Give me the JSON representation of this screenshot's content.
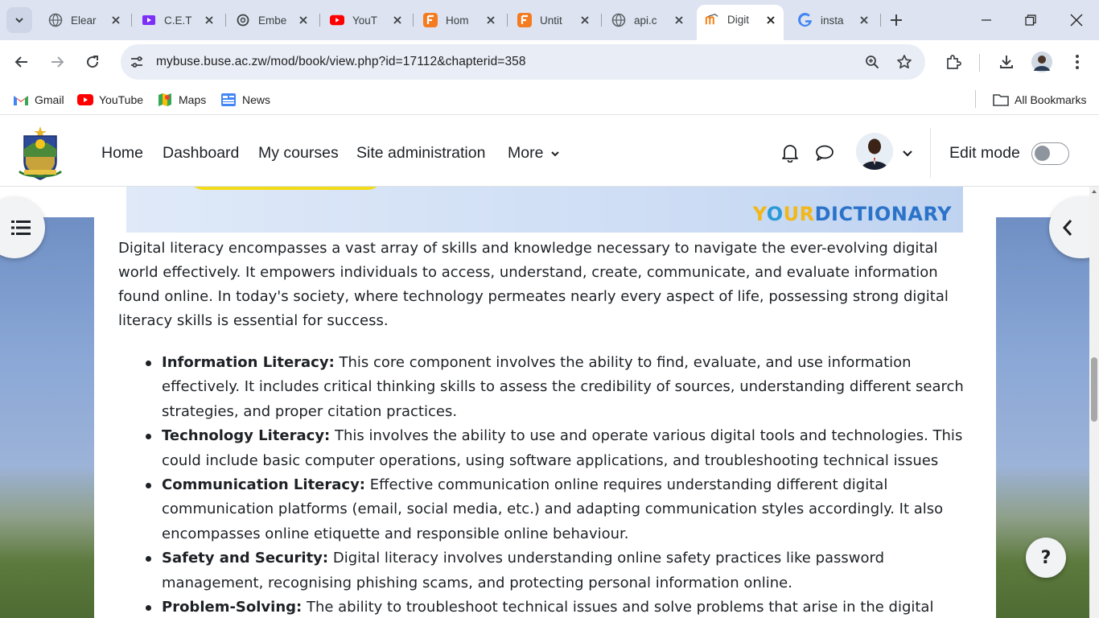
{
  "browser": {
    "tabs": [
      {
        "label": "Elear",
        "icon": "globe-icon"
      },
      {
        "label": "C.E.T",
        "icon": "video-icon"
      },
      {
        "label": "Embe",
        "icon": "openai-icon"
      },
      {
        "label": "YouT",
        "icon": "youtube-icon"
      },
      {
        "label": "Hom",
        "icon": "formative-icon"
      },
      {
        "label": "Untit",
        "icon": "formative-icon"
      },
      {
        "label": "api.c",
        "icon": "globe-icon"
      },
      {
        "label": "Digit",
        "icon": "moodle-icon",
        "active": true
      },
      {
        "label": "insta",
        "icon": "google-icon"
      }
    ],
    "url": "mybuse.buse.ac.zw/mod/book/view.php?id=17112&chapterid=358",
    "bookmarks": [
      {
        "label": "Gmail",
        "icon": "gmail-icon"
      },
      {
        "label": "YouTube",
        "icon": "youtube-icon"
      },
      {
        "label": "Maps",
        "icon": "maps-icon"
      },
      {
        "label": "News",
        "icon": "news-icon"
      }
    ],
    "all_bookmarks": "All Bookmarks"
  },
  "site_nav": {
    "links": [
      "Home",
      "Dashboard",
      "My courses",
      "Site administration",
      "More"
    ],
    "edit_mode": "Edit mode",
    "edit_mode_on": false
  },
  "banner": {
    "brand_prefix": "Y",
    "brand_ring": "O",
    "brand_rest": "UR",
    "brand_suffix": "DICTIONARY"
  },
  "content": {
    "intro": "Digital literacy encompasses a vast array of skills and knowledge necessary to navigate the ever-evolving digital world effectively. It empowers individuals to access, understand, create, communicate, and evaluate information found online. In today's society, where technology permeates nearly every aspect of life, possessing strong digital literacy skills is essential for success.",
    "items": [
      {
        "title": "Information Literacy:",
        "text": " This core component involves the ability to find, evaluate, and use information effectively. It includes critical thinking skills to assess the credibility of sources, understanding different search strategies, and proper citation practices."
      },
      {
        "title": "Technology Literacy:",
        "text": " This involves the ability to use and operate various digital tools and technologies. This could include basic computer operations, using software applications, and troubleshooting technical issues"
      },
      {
        "title": "Communication Literacy:",
        "text": " Effective communication online requires understanding different digital communication platforms (email, social media, etc.) and adapting communication styles accordingly. It also encompasses online etiquette and responsible online behaviour."
      },
      {
        "title": "Safety and Security:",
        "text": " Digital literacy involves understanding online safety practices like password management, recognising phishing scams, and protecting personal information online."
      },
      {
        "title": "Problem-Solving:",
        "text": " The ability to troubleshoot technical issues and solve problems that arise in the digital"
      }
    ]
  },
  "help_label": "?",
  "colors": {
    "tabstrip": "#dde3f0",
    "omnibox": "#e9edf6",
    "brand_yellow": "#f2b71a",
    "brand_blue": "#2b73c9",
    "text": "#1d2125"
  }
}
